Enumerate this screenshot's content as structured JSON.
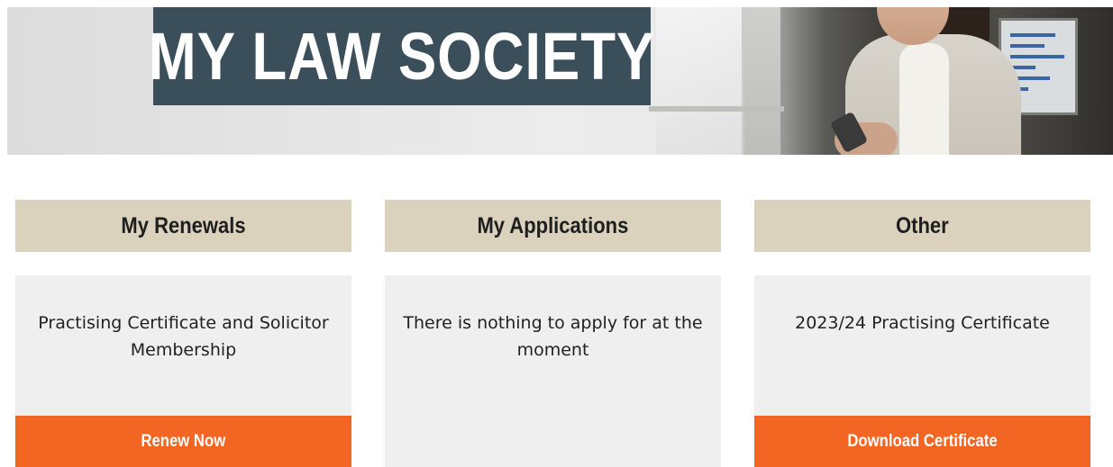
{
  "banner": {
    "title": "MY LAW SOCIETY"
  },
  "columns": [
    {
      "heading": "My Renewals",
      "text": "Practising Certificate and Solicitor Membership",
      "button_label": "Renew Now"
    },
    {
      "heading": "My Applications",
      "text": "There is nothing to apply for at the moment"
    },
    {
      "heading": "Other",
      "text": "2023/24 Practising Certificate",
      "button_label": "Download Certificate"
    }
  ],
  "colors": {
    "title_box": "#3b4f5b",
    "column_header": "#dbd2be",
    "card_background": "#efefef",
    "button": "#f26522"
  }
}
